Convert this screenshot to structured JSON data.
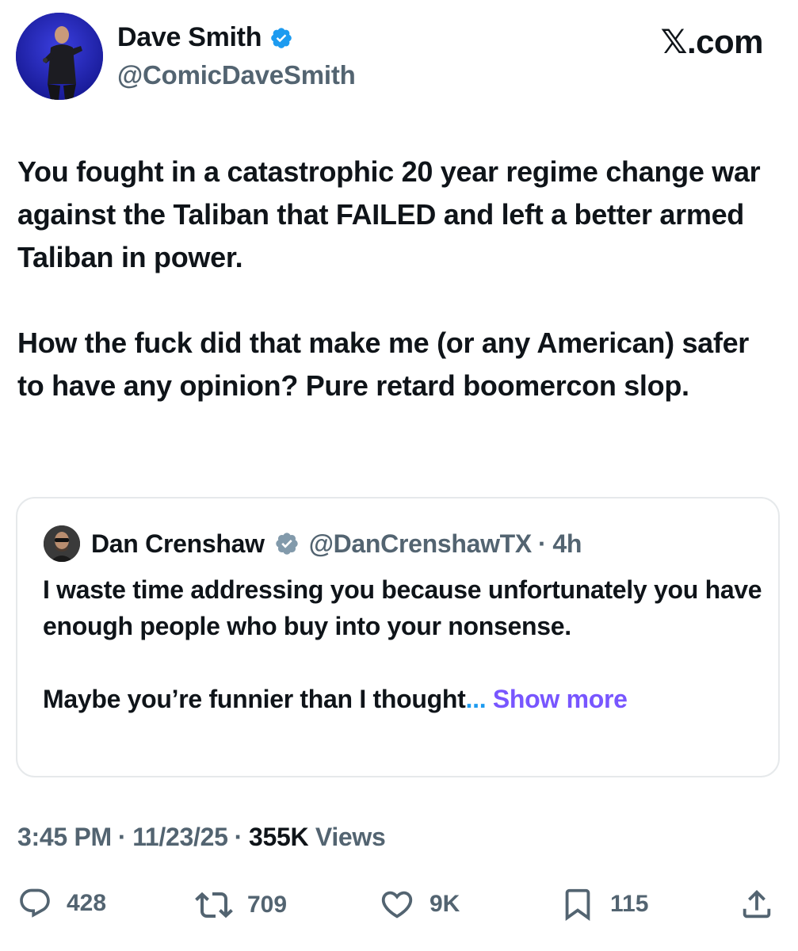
{
  "author": {
    "name": "Dave Smith",
    "handle": "@ComicDaveSmith",
    "verified_color": "#1d9bf0"
  },
  "brand": "𝕏.com",
  "tweet": {
    "paragraphs": [
      "You fought in a catastrophic 20 year regime change war against the Taliban that FAILED and left a better armed Taliban in power.",
      "How the fuck did that make me (or any American) safer to have any opinion? Pure retard boomercon slop."
    ]
  },
  "quote": {
    "name": "Dan Crenshaw",
    "handle": "@DanCrenshawTX",
    "separator": "·",
    "time": "4h",
    "verified_color": "#829aab",
    "paragraph1": "I waste time addressing you because unfortunately you have enough people who buy into your nonsense.",
    "paragraph2": "Maybe you’re funnier than I thought",
    "ellipsis": "...",
    "show_more": "Show more"
  },
  "meta": {
    "time": "3:45 PM",
    "separator": "·",
    "date": "11/23/25",
    "views_count": "355K",
    "views_label": "Views"
  },
  "actions": {
    "replies": "428",
    "reposts": "709",
    "likes": "9K",
    "bookmarks": "115",
    "icons": [
      "reply-icon",
      "repost-icon",
      "like-icon",
      "bookmark-icon",
      "share-icon"
    ]
  },
  "colors": {
    "text": "#0f1419",
    "secondary": "#536471",
    "link": "#7856ff",
    "border": "#e6e9eb"
  }
}
